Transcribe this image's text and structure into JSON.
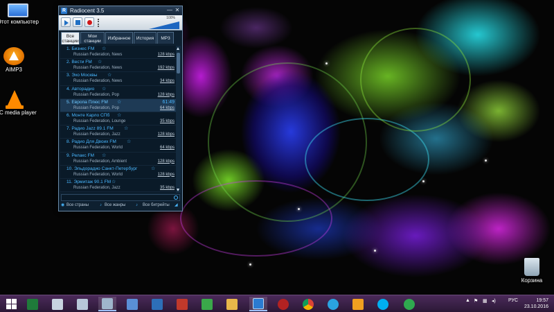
{
  "desktop": {
    "icons": [
      {
        "label": "Этот компьютер"
      },
      {
        "label": "AIMP3"
      },
      {
        "label": "VLC media player"
      },
      {
        "label": "Корзина"
      }
    ]
  },
  "window": {
    "title": "Radiocent 3.5",
    "minimize_glyph": "—",
    "close_glyph": "✕",
    "volume_label": "100%",
    "tabs": [
      {
        "label": "Все станции"
      },
      {
        "label": "Мои станции"
      },
      {
        "label": "Избранное"
      },
      {
        "label": "История"
      },
      {
        "label": "MP3"
      }
    ],
    "stations": [
      {
        "name": "1. Бизнес FM",
        "meta": "Russian Federation, News",
        "rate": "128 kbps"
      },
      {
        "name": "2. Вести FM",
        "meta": "Russian Federation, News",
        "rate": "192 kbps"
      },
      {
        "name": "3. Эхо Москвы",
        "meta": "Russian Federation, News",
        "rate": "34 kbps"
      },
      {
        "name": "4. Авторадио",
        "meta": "Russian Federation, Pop",
        "rate": "128 kbps"
      },
      {
        "name": "5. Европа Плюс FM",
        "meta": "Russian Federation, Pop",
        "rate": "64 kbps",
        "timer": "61:49"
      },
      {
        "name": "6. Монте Карло СПб",
        "meta": "Russian Federation, Lounge",
        "rate": "35 kbps"
      },
      {
        "name": "7. Радио Jazz 89.1 FM",
        "meta": "Russian Federation, Jazz",
        "rate": "128 kbps"
      },
      {
        "name": "8. Радио Для Двоих FM",
        "meta": "Russian Federation, World",
        "rate": "64 kbps"
      },
      {
        "name": "9. Релакс FM",
        "meta": "Russian Federation, Ambient",
        "rate": "128 kbps"
      },
      {
        "name": "10. Эльдорадио Санкт-Петербург",
        "meta": "Russian Federation, World",
        "rate": "128 kbps"
      },
      {
        "name": "11. Эрмитаж 90.1 FM",
        "meta": "Russian Federation, Jazz",
        "rate": "35 kbps"
      }
    ],
    "star_glyph": "☆",
    "search": {
      "value": ""
    },
    "filters": {
      "countries": "Все страны",
      "genres": "Все жанры",
      "bitrates": "Все битрейты"
    }
  },
  "taskbar": {
    "language": "РУС",
    "time": "19:57",
    "date": "23.10.2016"
  },
  "colors": {
    "accent": "#49b7ff",
    "taskbar": "#3b2148"
  }
}
